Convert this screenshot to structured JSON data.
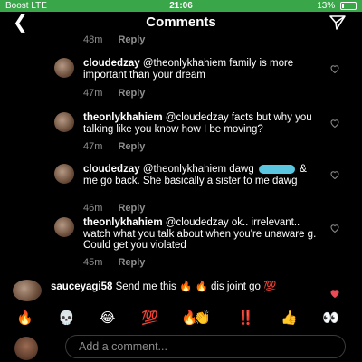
{
  "status": {
    "carrier": "Boost  LTE",
    "time": "21:06",
    "battery": "13%",
    "battery_level": 0.13
  },
  "header": {
    "title": "Comments"
  },
  "top_meta": {
    "time": "48m",
    "reply": "Reply"
  },
  "comments": [
    {
      "user": "cloudedzay",
      "text": "@theonlykhahiem family is more important than your dream",
      "time": "47m",
      "reply": "Reply"
    },
    {
      "user": "theonlykhahiem",
      "text": "@cloudedzay facts but why you talking like you know how I be moving?",
      "time": "47m",
      "reply": "Reply"
    },
    {
      "user": "cloudedzay",
      "text_before": "@theonlykhahiem dawg",
      "text_after": "& me go back. She basically a sister to me dawg",
      "time": "46m",
      "reply": "Reply"
    },
    {
      "user": "theonlykhahiem",
      "text": "@cloudedzay ok.. irrelevant.. watch what you talk about when you're unaware g. Could get you violated",
      "time": "45m",
      "reply": "Reply"
    },
    {
      "user": "sauceyagi58",
      "text": "Send me this 🔥 🔥  dis joint go 💯"
    }
  ],
  "emoji_bar": [
    "🔥",
    "💀",
    "😂",
    "💯",
    "🔥",
    "👏",
    "‼️",
    "👍",
    "👀"
  ],
  "input": {
    "placeholder": "Add a comment..."
  },
  "colors": {
    "status_bar": "#3aa64a",
    "heart_red": "#ed4956",
    "meta_gray": "#8e8e8e"
  }
}
